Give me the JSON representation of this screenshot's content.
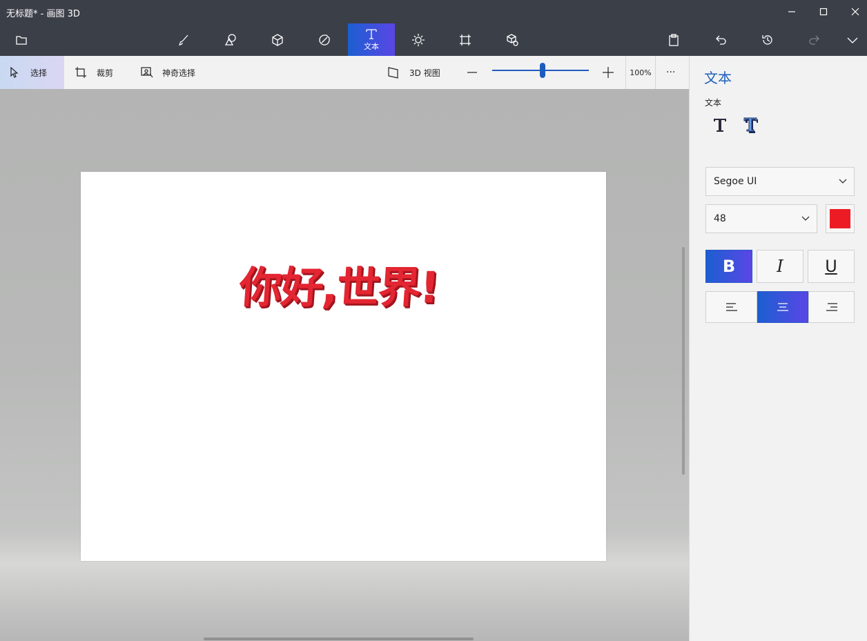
{
  "window": {
    "title": "无标题* - 画图 3D"
  },
  "toolbar": {
    "active_tool_label": "文本",
    "tools": [
      "folder-icon",
      "brush-icon",
      "shapes-2d-icon",
      "shapes-3d-icon",
      "stickers-icon",
      "text-icon",
      "effects-icon",
      "canvas-icon",
      "library-3d-icon",
      "paste-icon",
      "undo-icon",
      "history-icon",
      "redo-icon",
      "expand-icon"
    ]
  },
  "subbar": {
    "select_label": "选择",
    "crop_label": "裁剪",
    "magic_select_label": "神奇选择",
    "view3d_label": "3D 视图",
    "zoom_value": "100%",
    "zoom_fraction": 0.5,
    "more_label": "···"
  },
  "canvas": {
    "text": "你好,世界!",
    "text_color": "#e32632"
  },
  "panel": {
    "title": "文本",
    "section_label": "文本",
    "font_family": "Segoe UI",
    "font_size": "48",
    "color": "#ed1c24",
    "bold_label": "B",
    "italic_label": "I",
    "underline_label": "U",
    "bold_active": true,
    "align_active": "center"
  },
  "colors": {
    "accent": "#1f5fbf",
    "titlebar": "#3b3f48"
  }
}
